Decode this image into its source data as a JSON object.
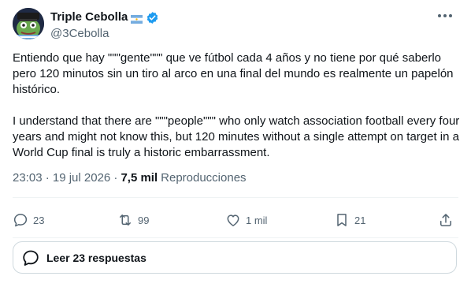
{
  "author": {
    "display_name": "Triple Cebolla",
    "handle": "@3Cebolla"
  },
  "tweet": {
    "text": "Entiendo que hay \"\"\"gente\"\"\" que ve fútbol cada 4 años y no tiene por qué saberlo pero 120 minutos sin un tiro al arco en una final del mundo es realmente un papelón histórico.\n\nI understand that there are \"\"\"people\"\"\" who only watch association football every four years and might not know this, but 120 minutes without a single attempt on target in a World Cup final is truly a historic embarrassment.",
    "timestamp": "23:03 · 19 jul 2026 ·",
    "views_count": "7,5 mil",
    "views_label": "Reproducciones"
  },
  "actions": {
    "reply_count": "23",
    "retweet_count": "99",
    "like_count": "1 mil",
    "bookmark_count": "21"
  },
  "read_replies": {
    "label": "Leer 23 respuestas"
  },
  "colors": {
    "text": "#0f1419",
    "secondary": "#536471",
    "verified_blue": "#1d9bf0",
    "border": "#cfd9de"
  },
  "icons": [
    "avatar-pepe",
    "argentina-flag-icon",
    "verified-badge-icon",
    "more-icon",
    "reply-icon",
    "retweet-icon",
    "like-icon",
    "bookmark-icon",
    "share-icon",
    "replies-bubble-icon"
  ]
}
